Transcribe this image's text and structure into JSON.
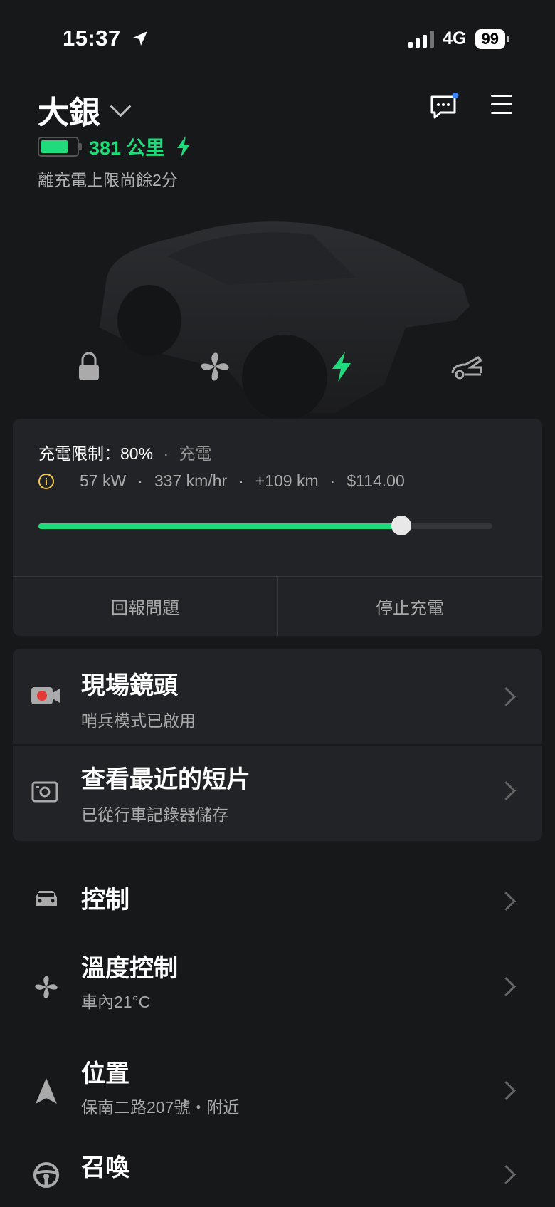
{
  "status": {
    "time": "15:37",
    "network": "4G",
    "battery": "99"
  },
  "header": {
    "car_name": "大銀",
    "range": "381 公里",
    "charge_note": "離充電上限尚餘2分"
  },
  "charge": {
    "limit_label": "充電限制：80%",
    "separator": "·",
    "state": "充電",
    "power": "57 kW",
    "rate": "337 km/hr",
    "added": "+109 km",
    "cost": "$114.00",
    "progress_fraction": 0.8,
    "report_button": "回報問題",
    "stop_button": "停止充電"
  },
  "camera": {
    "live": {
      "title": "現場鏡頭",
      "subtitle": "哨兵模式已啟用"
    },
    "clips": {
      "title": "查看最近的短片",
      "subtitle": "已從行車記錄器儲存"
    }
  },
  "menu": {
    "controls": {
      "title": "控制"
    },
    "climate": {
      "title": "溫度控制",
      "subtitle": "車內21°C"
    },
    "location": {
      "title": "位置",
      "subtitle": "保南二路207號・附近"
    },
    "summon": {
      "title": "召喚"
    }
  },
  "colors": {
    "accent": "#1fdb7b",
    "background": "#17181a",
    "card": "#222326",
    "notification_dot": "#3b82f6",
    "warning": "#f2c94c",
    "record": "#e53935"
  },
  "icons": [
    "location-arrow-icon",
    "chevron-down-icon",
    "message-icon",
    "menu-icon",
    "battery-icon",
    "bolt-icon",
    "lock-icon",
    "fan-icon",
    "charge-bolt-icon",
    "frunk-icon",
    "info-icon",
    "video-camera-icon",
    "camera-icon",
    "car-icon",
    "fan-icon",
    "navigation-icon",
    "steering-wheel-icon",
    "chevron-right-icon"
  ]
}
